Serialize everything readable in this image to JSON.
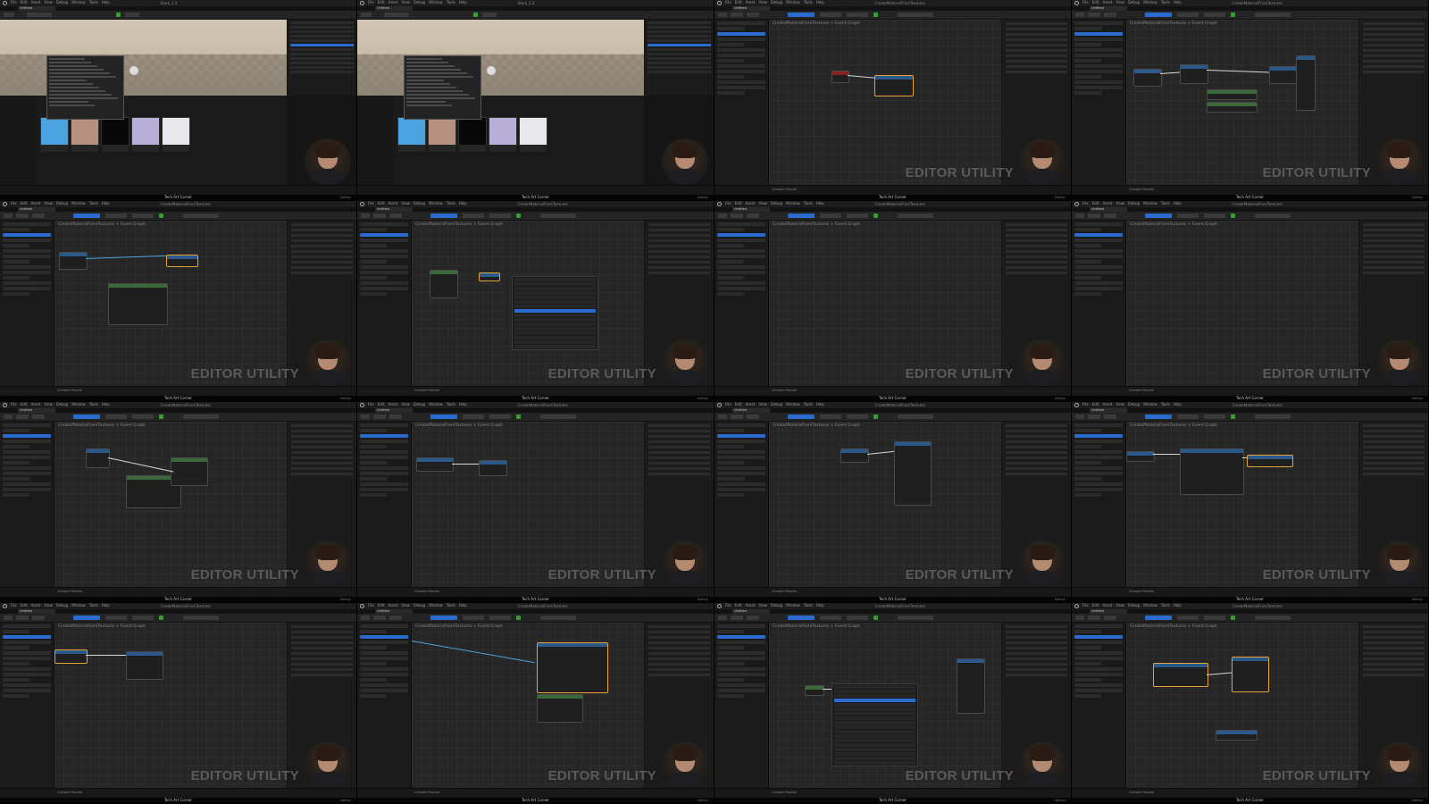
{
  "caption": "Tech Art Corner",
  "watermark": "EDITOR UTILITY",
  "udemy": "Udemy",
  "breadcrumb": "CreateMaterialFromTextures  >  Event Graph",
  "project_title": "Stark_5.3",
  "tab_untitled": "Untitled",
  "tab_cmft": "CreateMaterialFromTextures",
  "compile_results": "Compile Results",
  "menu": [
    "File",
    "Edit",
    "Asset",
    "View",
    "Debug",
    "Window",
    "Tools",
    "Help"
  ],
  "colors": {
    "accent": "#2a6bd0",
    "selected": "#e5a53b",
    "wire": "#d8d8d8",
    "watermark": "#5a5a5a"
  },
  "tiles": [
    {
      "kind": "level",
      "tooltip": true
    },
    {
      "kind": "level",
      "tooltip": true
    },
    {
      "kind": "graph",
      "variant": "event"
    },
    {
      "kind": "graph",
      "variant": "chain"
    },
    {
      "kind": "graph",
      "variant": "loose"
    },
    {
      "kind": "graph",
      "variant": "menu"
    },
    {
      "kind": "graph",
      "variant": "empty"
    },
    {
      "kind": "graph",
      "variant": "empty"
    },
    {
      "kind": "graph",
      "variant": "function"
    },
    {
      "kind": "graph",
      "variant": "small"
    },
    {
      "kind": "graph",
      "variant": "pair"
    },
    {
      "kind": "graph",
      "variant": "wide"
    },
    {
      "kind": "graph",
      "variant": "select"
    },
    {
      "kind": "graph",
      "variant": "bignode"
    },
    {
      "kind": "graph",
      "variant": "menu2"
    },
    {
      "kind": "graph",
      "variant": "sel2"
    }
  ]
}
